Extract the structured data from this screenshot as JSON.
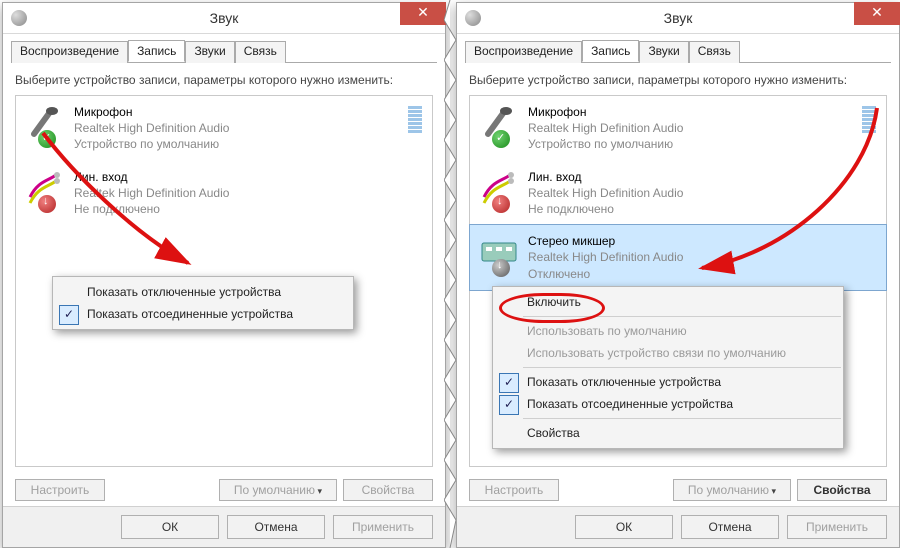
{
  "window_title": "Звук",
  "tabs": [
    "Воспроизведение",
    "Запись",
    "Звуки",
    "Связь"
  ],
  "active_tab_index": 1,
  "instruction": "Выберите устройство записи, параметры которого нужно изменить:",
  "devices_left": [
    {
      "name": "Микрофон",
      "sub": "Realtek High Definition Audio",
      "status": "Устройство по умолчанию",
      "badge": "green",
      "icon": "microphone"
    },
    {
      "name": "Лин. вход",
      "sub": "Realtek High Definition Audio",
      "status": "Не подключено",
      "badge": "red",
      "icon": "linein"
    }
  ],
  "devices_right": [
    {
      "name": "Микрофон",
      "sub": "Realtek High Definition Audio",
      "status": "Устройство по умолчанию",
      "badge": "green",
      "icon": "microphone"
    },
    {
      "name": "Лин. вход",
      "sub": "Realtek High Definition Audio",
      "status": "Не подключено",
      "badge": "red",
      "icon": "linein"
    },
    {
      "name": "Стерео микшер",
      "sub": "Realtek High Definition Audio",
      "status": "Отключено",
      "badge": "gray",
      "icon": "mixer",
      "selected": true
    }
  ],
  "ctx_left": {
    "items": [
      {
        "label": "Показать отключенные устройства",
        "checked": false
      },
      {
        "label": "Показать отсоединенные устройства",
        "checked": true
      }
    ]
  },
  "ctx_right": {
    "enable": "Включить",
    "set_default": "Использовать по умолчанию",
    "set_comm_default": "Использовать устройство связи по умолчанию",
    "show_disabled": "Показать отключенные устройства",
    "show_disconnected": "Показать отсоединенные устройства",
    "properties": "Свойства"
  },
  "buttons": {
    "configure": "Настроить",
    "default": "По умолчанию",
    "properties": "Свойства",
    "ok": "ОК",
    "cancel": "Отмена",
    "apply": "Применить"
  }
}
